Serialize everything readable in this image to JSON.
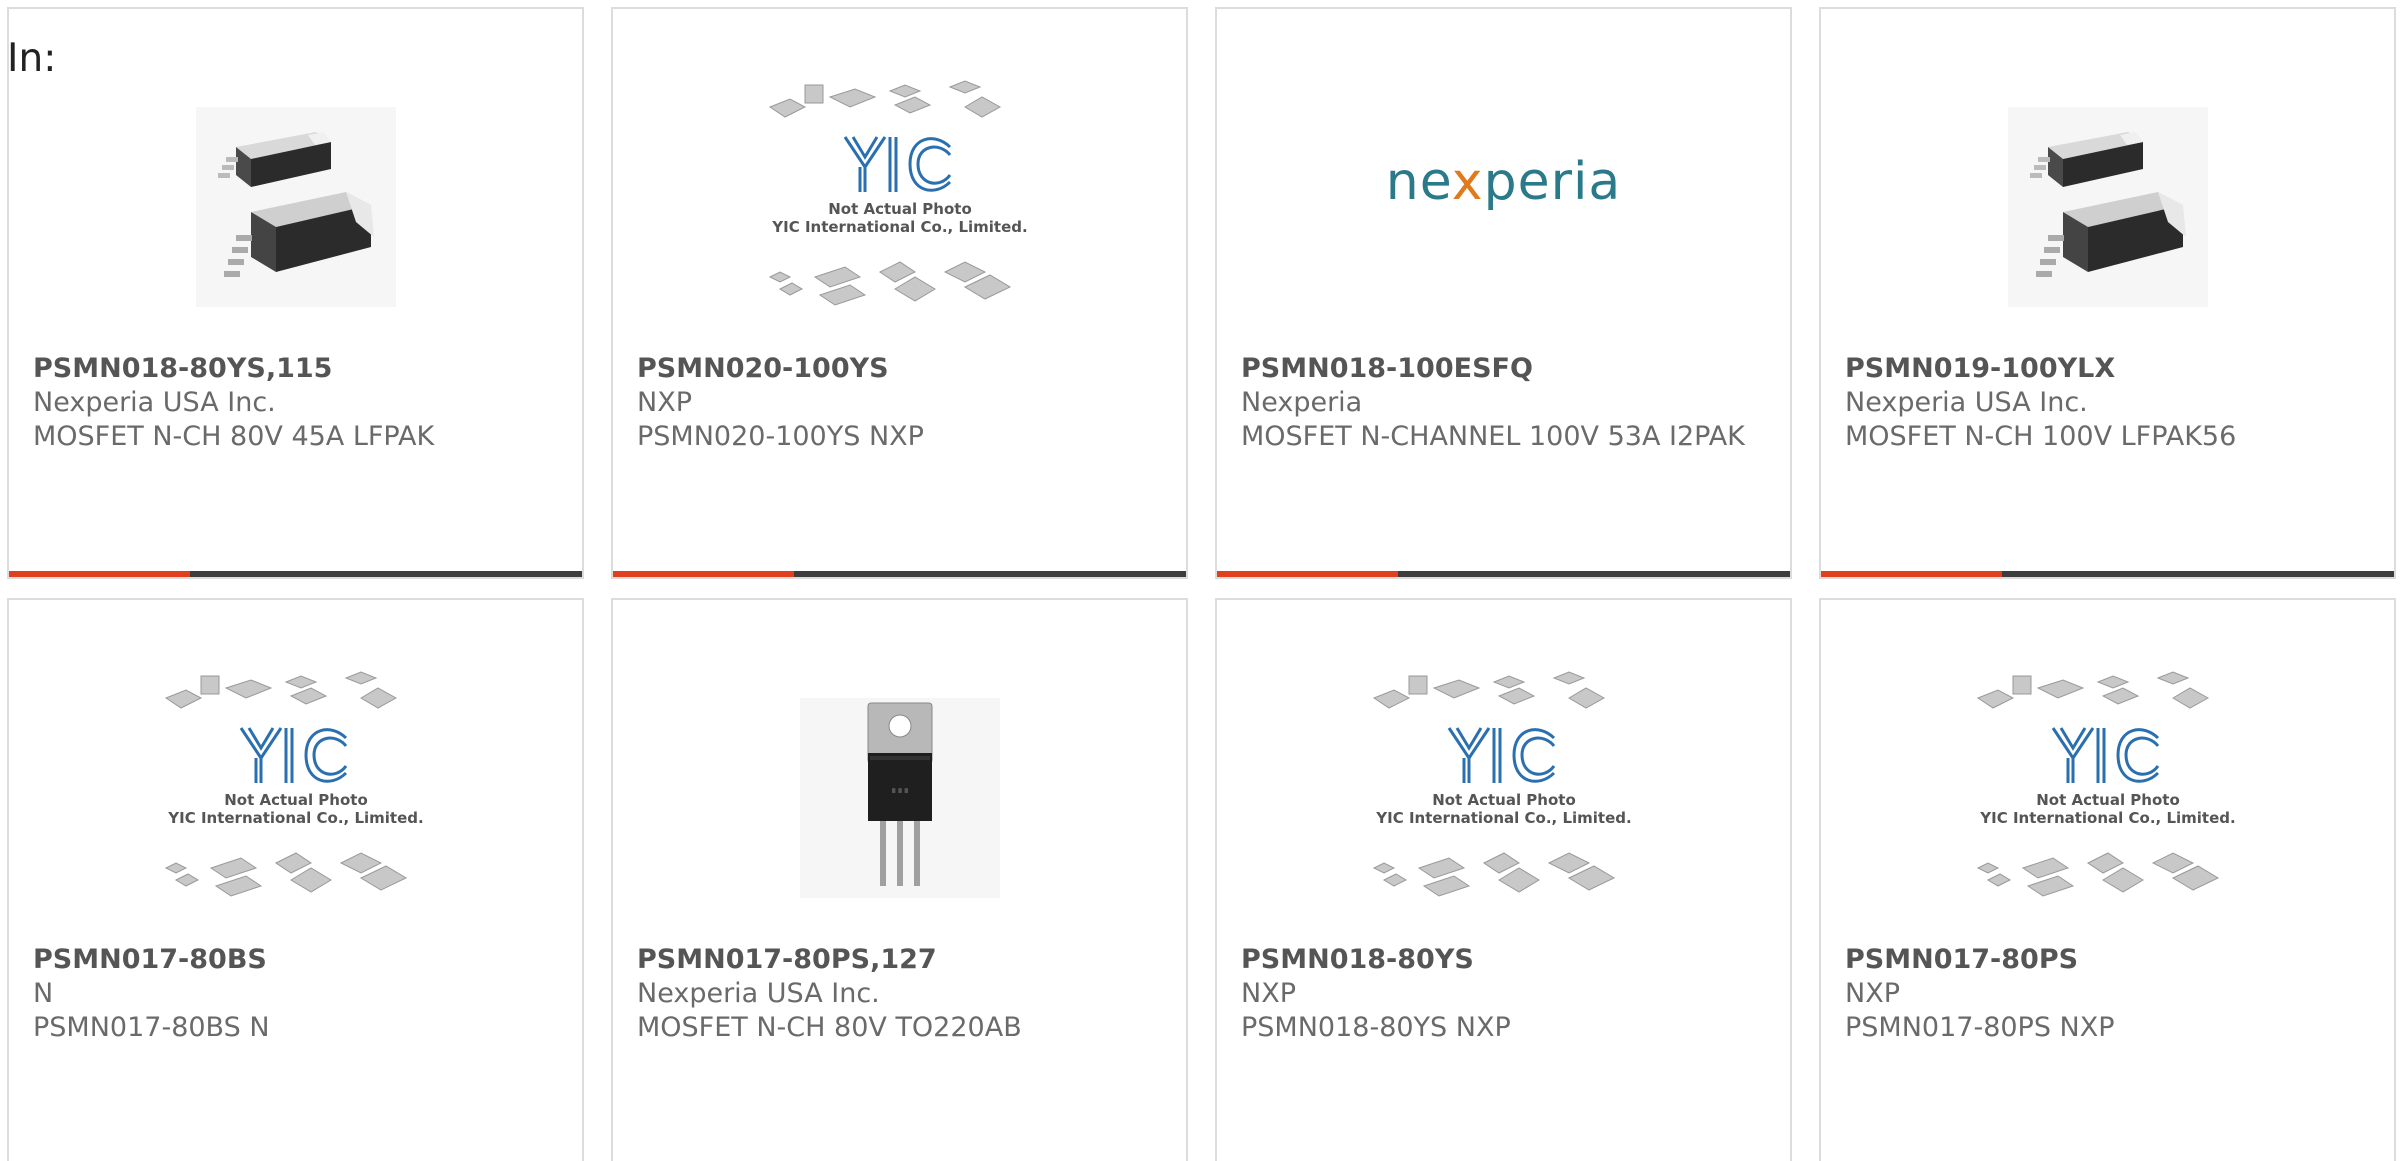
{
  "page": {
    "label": "In:"
  },
  "products": [
    {
      "part": "PSMN018-80YS,115",
      "maker": "Nexperia USA Inc.",
      "desc": "MOSFET N-CH 80V 45A LFPAK",
      "image": "lfpak-package-photo"
    },
    {
      "part": "PSMN020-100YS",
      "maker": "NXP",
      "desc": "PSMN020-100YS NXP",
      "image": "yic-placeholder",
      "image_text": {
        "logo": "YIC",
        "line1": "Not Actual Photo",
        "line2": "YIC International Co., Limited."
      }
    },
    {
      "part": "PSMN018-100ESFQ",
      "maker": "Nexperia",
      "desc": "MOSFET N-CHANNEL 100V 53A I2PAK",
      "image": "nexperia-logo",
      "image_text": {
        "logo_prefix": "ne",
        "logo_x": "x",
        "logo_suffix": "peria"
      }
    },
    {
      "part": "PSMN019-100YLX",
      "maker": "Nexperia USA Inc.",
      "desc": "MOSFET N-CH 100V LFPAK56",
      "image": "lfpak-package-photo"
    },
    {
      "part": "PSMN017-80BS",
      "maker": "N",
      "desc": "PSMN017-80BS N",
      "image": "yic-placeholder",
      "image_text": {
        "logo": "YIC",
        "line1": "Not Actual Photo",
        "line2": "YIC International Co., Limited."
      }
    },
    {
      "part": "PSMN017-80PS,127",
      "maker": "Nexperia USA Inc.",
      "desc": "MOSFET N-CH 80V TO220AB",
      "image": "to220-package-photo"
    },
    {
      "part": "PSMN018-80YS",
      "maker": "NXP",
      "desc": "PSMN018-80YS NXP",
      "image": "yic-placeholder",
      "image_text": {
        "logo": "YIC",
        "line1": "Not Actual Photo",
        "line2": "YIC International Co., Limited."
      }
    },
    {
      "part": "PSMN017-80PS",
      "maker": "NXP",
      "desc": "PSMN017-80PS NXP",
      "image": "yic-placeholder",
      "image_text": {
        "logo": "YIC",
        "line1": "Not Actual Photo",
        "line2": "YIC International Co., Limited."
      }
    }
  ],
  "colors": {
    "accent": "#e0401c",
    "bar": "#3d3d3d",
    "border": "#dcdcdc",
    "text": "#6a6a6a",
    "yic_blue": "#2a6fb0",
    "nexperia_teal": "#2a7a8a",
    "nexperia_orange": "#e07a1c"
  }
}
